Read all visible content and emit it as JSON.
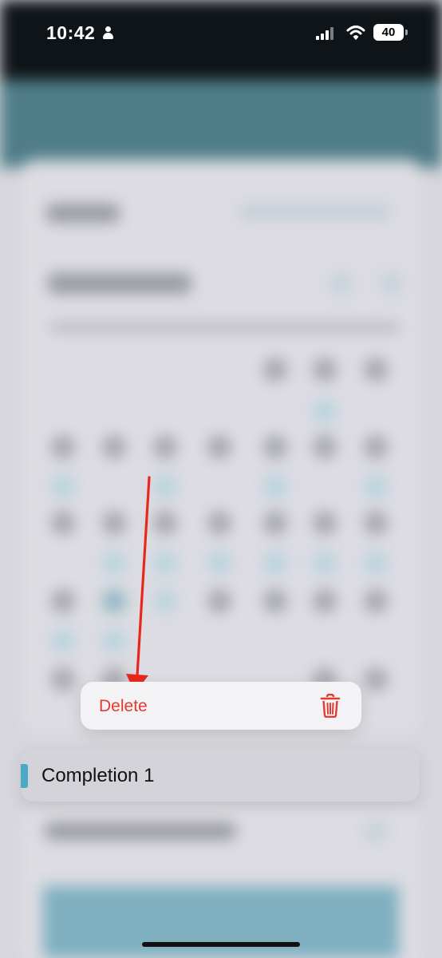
{
  "status_bar": {
    "time": "10:42",
    "battery_level": "40",
    "icons": [
      "person-icon",
      "signal-icon",
      "wifi-icon",
      "battery-icon"
    ]
  },
  "context_menu": {
    "delete_label": "Delete",
    "delete_icon": "trash-icon",
    "destructive_color": "#e43a30"
  },
  "preview": {
    "title": "Completion 1",
    "accent_color": "#4aa9c7"
  },
  "annotation": {
    "arrow_color": "#e8281c"
  }
}
